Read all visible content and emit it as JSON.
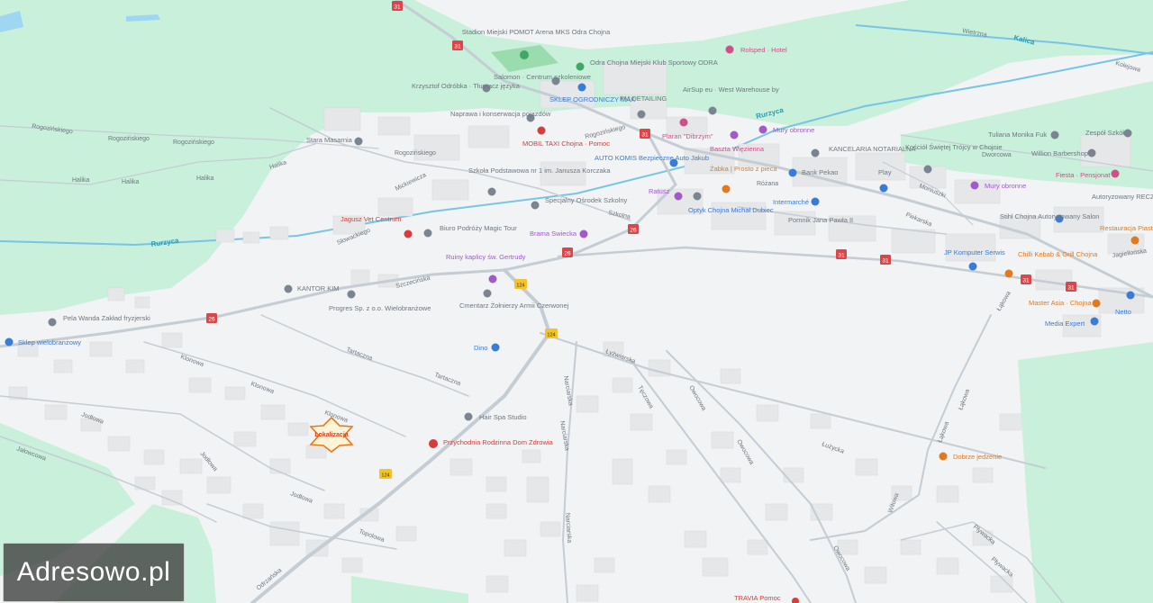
{
  "labels": {
    "stadium": "Stadion Miejski POMOT Arena MKS Odra Chojna",
    "klub": "Odra Chojna Miejski Klub Sportowy ODRA",
    "rolsped": "Rolsped · Hotel",
    "salomon": "Salomon · Centrum szkoleniowe",
    "odrobka": "Krzysztof Odróbka · Tłumacz języka",
    "sklep_ogrodniczy": "SKLEP OGRODNICZY MAK",
    "pm_detailing": "PM DETAILING",
    "airsup": "AirSup eu · West Warehouse by",
    "naprawa": "Naprawa i konserwacja pojazdów",
    "mobil_taxi": "MOBIL TAXI Chojna · Pomoc",
    "plaran": "Plaran \"Dibrzym\"",
    "baszta": "Baszta Więzienna",
    "mury_obronne_1": "Mury obronne",
    "kancelaria": "KANCELARIA NOTARIALNA",
    "kosciol": "Kościół Świętej Trójcy w Chojnie",
    "tuliana": "Tuliana Monika Fuk",
    "zespol": "Zespół Szkół",
    "willion": "Willion Barbershop",
    "stara_masarnia": "Stara Masarnia",
    "szkola": "Szkoła Podstawowa nr 1 im. Janusza Korczaka",
    "auto_komis": "AUTO KOMIS Bezpieczne Auto Jakub",
    "zabka": "Żabka | Prosto z pieca",
    "bank": "Bank Pekao",
    "play": "Play",
    "fiesta": "Fiesta · Pensjonat",
    "autoryzowany": "Autoryzowany RECZNA",
    "mury_obronne_2": "Mury obronne",
    "specjalny": "Specjalny Ośrodek Szkolny",
    "ratusz": "Ratusz",
    "intermarche": "Intermarché",
    "optyk": "Optyk Chojna Michał Dubiec",
    "pomnik": "Pomnik Jana Pawła II",
    "stihl": "Stihl Chojna Autoryzowany Salon",
    "restauracja": "Restauracja Piast",
    "jagusz": "Jagusz Vet Centrum",
    "biuro": "Biuro Podróży Magic Tour",
    "brama": "Brama Swiecka",
    "chilli": "Chilli Kebab & Grill Chojna",
    "jp_komputer": "JP Komputer Serwis",
    "ruiny": "Ruiny kaplicy św. Gertrudy",
    "kantor": "KANTOR KIM",
    "progres": "Progres Sp. z o.o. Wielobranżowe",
    "cmentarz": "Cmentarz Żołnierzy Armii Czerwonej",
    "master_asia": "Master Asia · Chojna",
    "netto": "Netto",
    "media_expert": "Media Expert",
    "pela_wanda": "Pela Wanda Zakład fryzjerski",
    "sklep_wielobranzowy": "Sklep wielobranżowy",
    "dino": "Dino",
    "hair_spa": "Hair Spa Studio",
    "przychodnia": "Przychodnia Rodzinna Dom Zdrowia",
    "dobrze": "Dobrze jedzenie",
    "travia": "TRAVIA Pomoc"
  },
  "streets": {
    "rogozinskiego_1": "Rogozińskiego",
    "rogozinskiego_2": "Rogozińskiego",
    "rogozinskiego_3": "Rogozińskiego",
    "rogozinskiego_4": "Rogozińskiego",
    "rogozinskiego_5": "Rogozińskiego",
    "halika_1": "Halika",
    "halika_2": "Halika",
    "halika_3": "Halika",
    "halika_4": "Halika",
    "mickiewicza": "Mickiewicza",
    "slowackiego": "Słowackiego",
    "szczecinska": "Szczecińska",
    "szkolna": "Szkolna",
    "rozana": "Różana",
    "piekarska": "Piekarska",
    "moniuszki": "Moniuszki",
    "dworcowa": "Dworcowa",
    "jagiellonska": "Jagiellońska",
    "wietrzna": "Wietrzna",
    "kolejowa": "Kolejowa",
    "tartaczna_1": "Tartaczna",
    "tartaczna_2": "Tartaczna",
    "klonowa_1": "Klonowa",
    "klonowa_2": "Klonowa",
    "klonowa_3": "Klonowa",
    "jodlowa_1": "Jodłowa",
    "jodlowa_2": "Jodłowa",
    "jodlowa_3": "Jodłowa",
    "jalowcowa": "Jałowcowa",
    "topolowa": "Topolowa",
    "odrzanska": "Odrzańska",
    "lyzwiarska": "Łyżwiarska",
    "narciarska_1": "Narciarska",
    "narciarska_2": "Narciarska",
    "narciarska_3": "Narciarska",
    "owocowa_1": "Owocowa",
    "owocowa_2": "Owocowa",
    "owocowa_3": "Owocowa",
    "luzyca": "Łużycka",
    "lakowa_1": "Łąkowa",
    "lakowa_2": "Łąkowa",
    "lakowa_3": "Łąkowa",
    "wilowa": "Wiłowa",
    "plywacka": "Pływacka",
    "plywacka_2": "Pływacka",
    "tecza": "Tęczowa"
  },
  "water": {
    "rurzyca_1": "Rurzyca",
    "rurzyca_2": "Rurzyca",
    "kalica": "Kalica"
  },
  "road_numbers": {
    "r31": "31",
    "r26": "26",
    "r124": "124"
  },
  "marker": {
    "label": "Lokalizacja"
  },
  "watermark": {
    "text": "Adresowo.pl"
  },
  "colors": {
    "background": "#f2f3f4",
    "green_area": "#c6f0d8",
    "water_label": "#2c9bb0",
    "road_shield": "#d9474b",
    "road_124": "#f3c327",
    "marker_fill": "#fff4d6",
    "marker_stroke": "#e8781e",
    "marker_text": "#e03a1a"
  }
}
